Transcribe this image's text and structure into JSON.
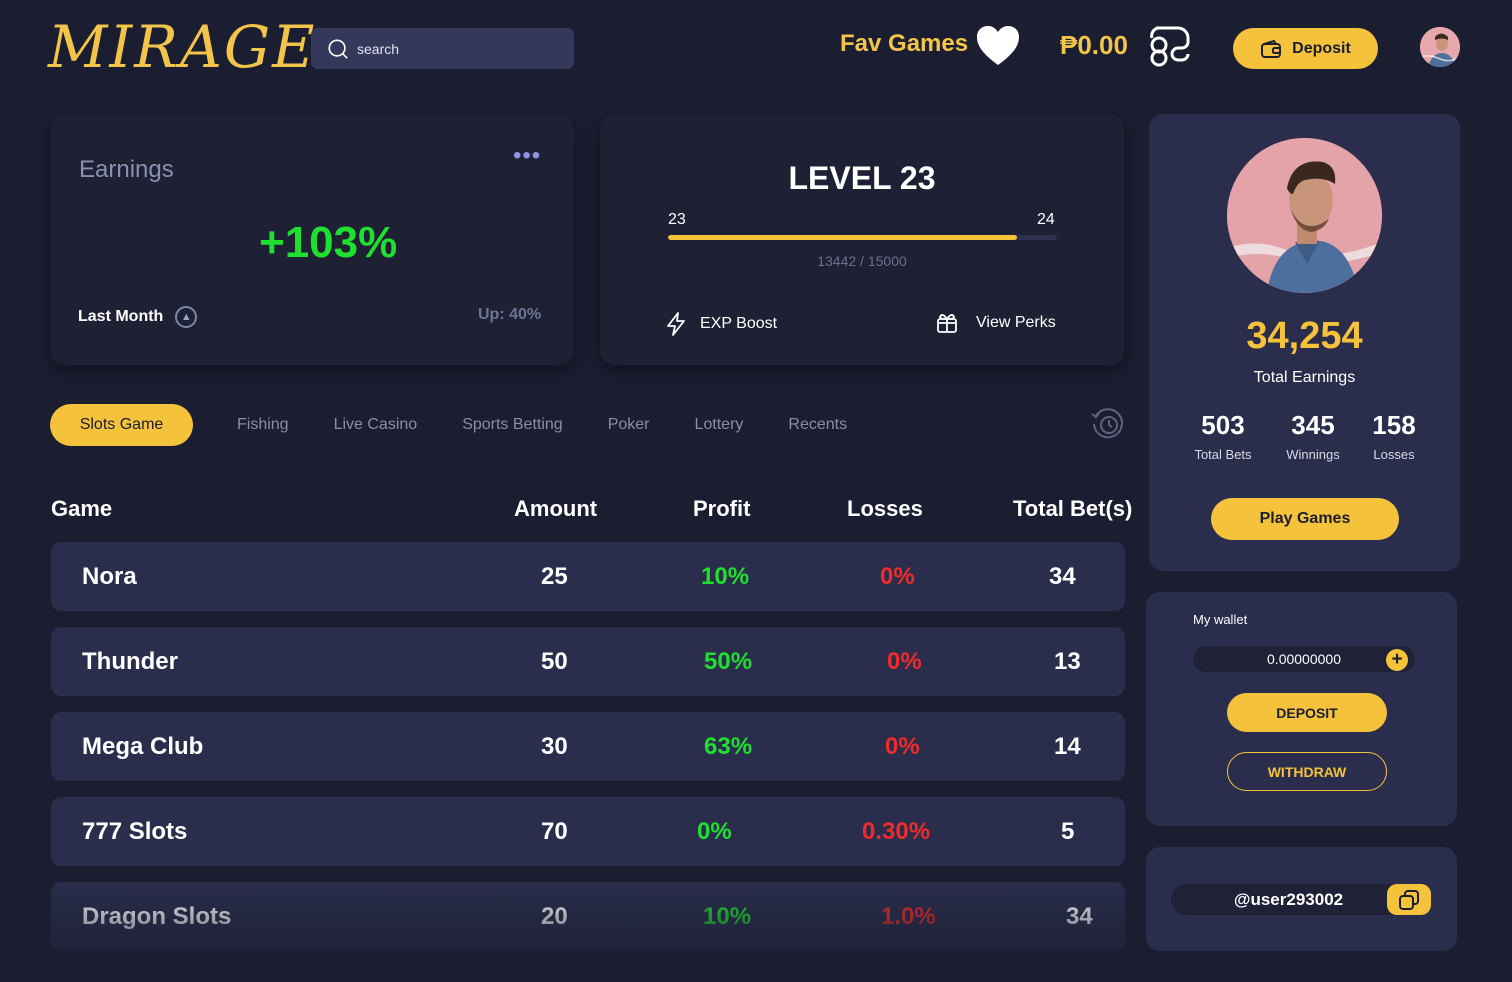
{
  "header": {
    "logo_text": "MIRAGE",
    "search_placeholder": "search",
    "fav_label": "Fav Games",
    "balance": "₱0.00",
    "deposit_label": "Deposit"
  },
  "earnings": {
    "title": "Earnings",
    "value": "+103%",
    "period": "Last Month",
    "change": "Up: 40%"
  },
  "level": {
    "title": "LEVEL 23",
    "from": "23",
    "to": "24",
    "xp_text": "13442 / 15000",
    "progress": 0.8961,
    "exp_boost_label": "EXP Boost",
    "view_perks_label": "View Perks"
  },
  "tabs": [
    "Slots Game",
    "Fishing",
    "Live Casino",
    "Sports Betting",
    "Poker",
    "Lottery",
    "Recents"
  ],
  "table": {
    "headers": {
      "game": "Game",
      "amount": "Amount",
      "profit": "Profit",
      "losses": "Losses",
      "total": "Total Bet(s)"
    },
    "rows": [
      {
        "game": "Nora",
        "amount": "25",
        "profit": "10%",
        "losses": "0%",
        "total": "34"
      },
      {
        "game": "Thunder",
        "amount": "50",
        "profit": "50%",
        "losses": "0%",
        "total": "13"
      },
      {
        "game": "Mega Club",
        "amount": "30",
        "profit": "63%",
        "losses": "0%",
        "total": "14"
      },
      {
        "game": "777 Slots",
        "amount": "70",
        "profit": "0%",
        "losses": "0.30%",
        "total": "5"
      },
      {
        "game": "Dragon Slots",
        "amount": "20",
        "profit": "10%",
        "losses": "1.0%",
        "total": "34"
      }
    ]
  },
  "profile": {
    "total_earnings": "34,254",
    "total_earnings_label": "Total Earnings",
    "stats": [
      {
        "value": "503",
        "label": "Total Bets"
      },
      {
        "value": "345",
        "label": "Winnings"
      },
      {
        "value": "158",
        "label": "Losses"
      }
    ],
    "play_label": "Play Games"
  },
  "wallet": {
    "label": "My wallet",
    "amount": "0.00000000",
    "deposit_label": "DEPOSIT",
    "withdraw_label": "WITHDRAW"
  },
  "user": {
    "handle": "@user293002"
  },
  "colors": {
    "accent": "#f5c33b",
    "background": "#1b1d31",
    "panel": "#2a2d4b",
    "profit": "#1ee12f",
    "loss": "#ef2b2b"
  }
}
